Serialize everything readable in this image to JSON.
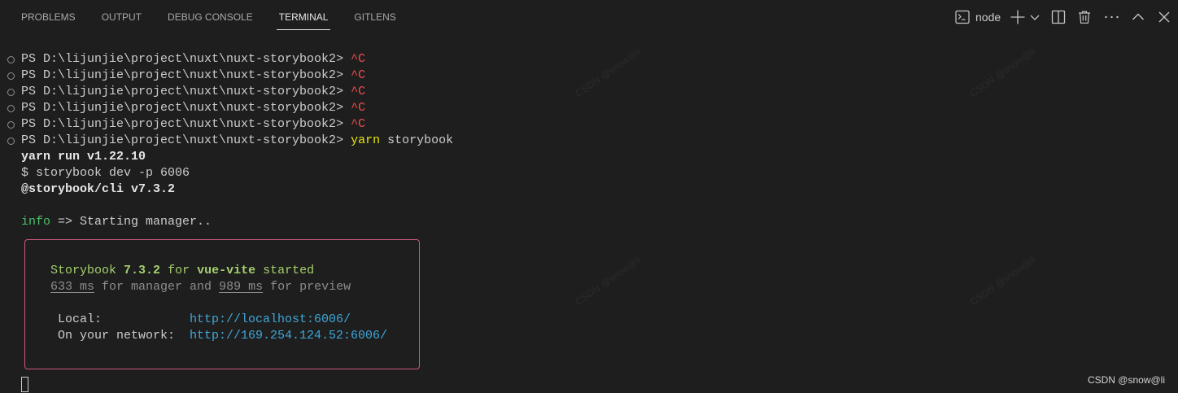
{
  "panel": {
    "tabs": [
      {
        "label": "PROBLEMS",
        "active": false
      },
      {
        "label": "OUTPUT",
        "active": false
      },
      {
        "label": "DEBUG CONSOLE",
        "active": false
      },
      {
        "label": "TERMINAL",
        "active": true
      },
      {
        "label": "GITLENS",
        "active": false
      }
    ],
    "toolbar": {
      "terminal_selector_label": "node",
      "icons": [
        "terminal-icon",
        "plus-icon",
        "chevron-down-icon",
        "split-terminal-icon",
        "trash-icon",
        "ellipsis-icon",
        "chevron-up-icon",
        "close-icon"
      ]
    }
  },
  "terminal": {
    "history": [
      {
        "prompt": "PS D:\\lijunjie\\project\\nuxt\\nuxt-storybook2>",
        "input": "^C"
      },
      {
        "prompt": "PS D:\\lijunjie\\project\\nuxt\\nuxt-storybook2>",
        "input": "^C"
      },
      {
        "prompt": "PS D:\\lijunjie\\project\\nuxt\\nuxt-storybook2>",
        "input": "^C"
      },
      {
        "prompt": "PS D:\\lijunjie\\project\\nuxt\\nuxt-storybook2>",
        "input": "^C"
      },
      {
        "prompt": "PS D:\\lijunjie\\project\\nuxt\\nuxt-storybook2>",
        "input": "^C"
      },
      {
        "prompt": "PS D:\\lijunjie\\project\\nuxt\\nuxt-storybook2>",
        "input": "yarn",
        "args": "storybook"
      }
    ],
    "output": {
      "run_header": "yarn run v1.22.10",
      "script_line": "$ storybook dev -p 6006",
      "cli_version": "@storybook/cli v7.3.2",
      "log": {
        "level": "info",
        "message": "=> Starting manager.."
      }
    },
    "startup_box": {
      "title": {
        "product": "Storybook",
        "version": "7.3.2",
        "connector": "for",
        "framework": "vue-vite",
        "status": "started"
      },
      "timing": {
        "manager_time": "633 ms",
        "manager_label": "for manager and",
        "preview_time": "989 ms",
        "preview_label": "for preview"
      },
      "urls": [
        {
          "label": "Local:",
          "url": "http://localhost:6006/"
        },
        {
          "label": "On your network:",
          "url": "http://169.254.124.52:6006/"
        }
      ]
    }
  },
  "watermark": "CSDN @snow@li",
  "colors": {
    "background": "#1e1e1e",
    "foreground": "#cccccc",
    "foreground_bright": "#e6e6e6",
    "interrupt_red": "#f14c4c",
    "command_yellow": "#e5e510",
    "info_green": "#4bbf6b",
    "banner_green": "#a4d06c",
    "timing_gray": "#8c8c8c",
    "link_cyan": "#3ea7d9",
    "box_border_pink": "#d0587f",
    "tab_active": "#e7e7e7",
    "tab_inactive": "#a9a9a9",
    "icon": "#c5c5c5",
    "decoration": "#8f8f8f"
  }
}
